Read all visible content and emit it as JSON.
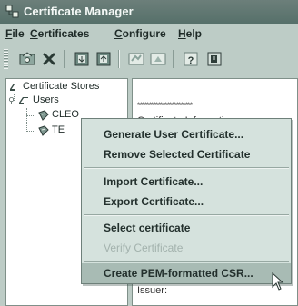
{
  "window": {
    "title": "Certificate Manager"
  },
  "menubar": {
    "items": [
      {
        "label": "File"
      },
      {
        "label": "Certificates"
      },
      {
        "label": "Configure"
      },
      {
        "label": "Help"
      }
    ]
  },
  "toolbar": {
    "buttons": [
      {
        "name": "open-icon"
      },
      {
        "name": "delete-icon"
      },
      {
        "name": "import-icon"
      },
      {
        "name": "export-icon"
      },
      {
        "name": "certificate-icon"
      },
      {
        "name": "key-icon"
      },
      {
        "name": "help-icon"
      },
      {
        "name": "document-icon"
      }
    ]
  },
  "tree": {
    "root": "Certificate Stores",
    "users": "Users",
    "child1": "CLEO",
    "child2": "TE"
  },
  "detail": {
    "stars": "************************",
    "cert_info": "Certificate Information",
    "issuer": "Issuer:"
  },
  "context_menu": {
    "items": [
      {
        "label": "Generate User Certificate...",
        "enabled": true
      },
      {
        "label": "Remove Selected Certificate",
        "enabled": true
      },
      {
        "label": "Import Certificate...",
        "enabled": true
      },
      {
        "label": "Export Certificate...",
        "enabled": true
      },
      {
        "label": "Select certificate",
        "enabled": true
      },
      {
        "label": "Verify Certificate",
        "enabled": false
      },
      {
        "label": "Create PEM-formatted CSR...",
        "enabled": true,
        "selected": true
      }
    ]
  },
  "colors": {
    "window_bg": "#bdccc6",
    "titlebar": "#5f7570",
    "menu_bg": "#d5e2dd",
    "selection": "#a8bbb4",
    "disabled_text": "#a3b2ad"
  }
}
